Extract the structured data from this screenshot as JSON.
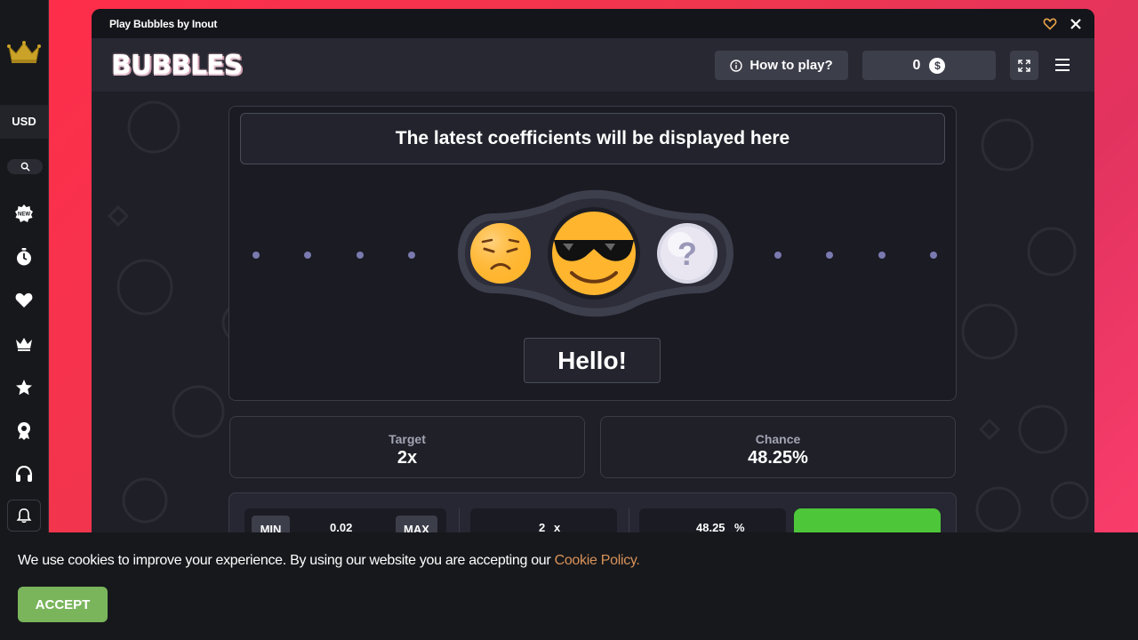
{
  "sidebar": {
    "currency": "USD",
    "items": [
      {
        "icon": "new-badge-icon"
      },
      {
        "icon": "timer-icon"
      },
      {
        "icon": "heart-icon"
      },
      {
        "icon": "crown-icon"
      },
      {
        "icon": "star-icon"
      },
      {
        "icon": "trophy-icon"
      },
      {
        "icon": "headset-icon"
      },
      {
        "icon": "bell-icon"
      }
    ]
  },
  "window": {
    "title": "Play Bubbles by Inout"
  },
  "game": {
    "logo": "BUBBLES",
    "how_to_play": "How to play?",
    "balance": "0",
    "currency_symbol": "$",
    "coefficients_placeholder": "The latest coefficients will be displayed here",
    "greeting": "Hello!",
    "unknown_glyph": "?",
    "target_label": "Target",
    "target_value": "2x",
    "chance_label": "Chance",
    "chance_value": "48.25%",
    "controls": {
      "min_label": "MIN",
      "bet_value": "0.02",
      "max_label": "MAX",
      "target_input": "2",
      "target_unit": "x",
      "chance_input": "48.25",
      "chance_unit": "%"
    }
  },
  "cookie": {
    "text": "We use cookies to improve your experience. By using our website you are accepting our ",
    "link": "Cookie Policy.",
    "accept": "ACCEPT"
  },
  "colors": {
    "background_red": "#ff2d4a",
    "play_green": "#4ec63a",
    "accept_green": "#7ab55c",
    "link_orange": "#d9935a"
  }
}
